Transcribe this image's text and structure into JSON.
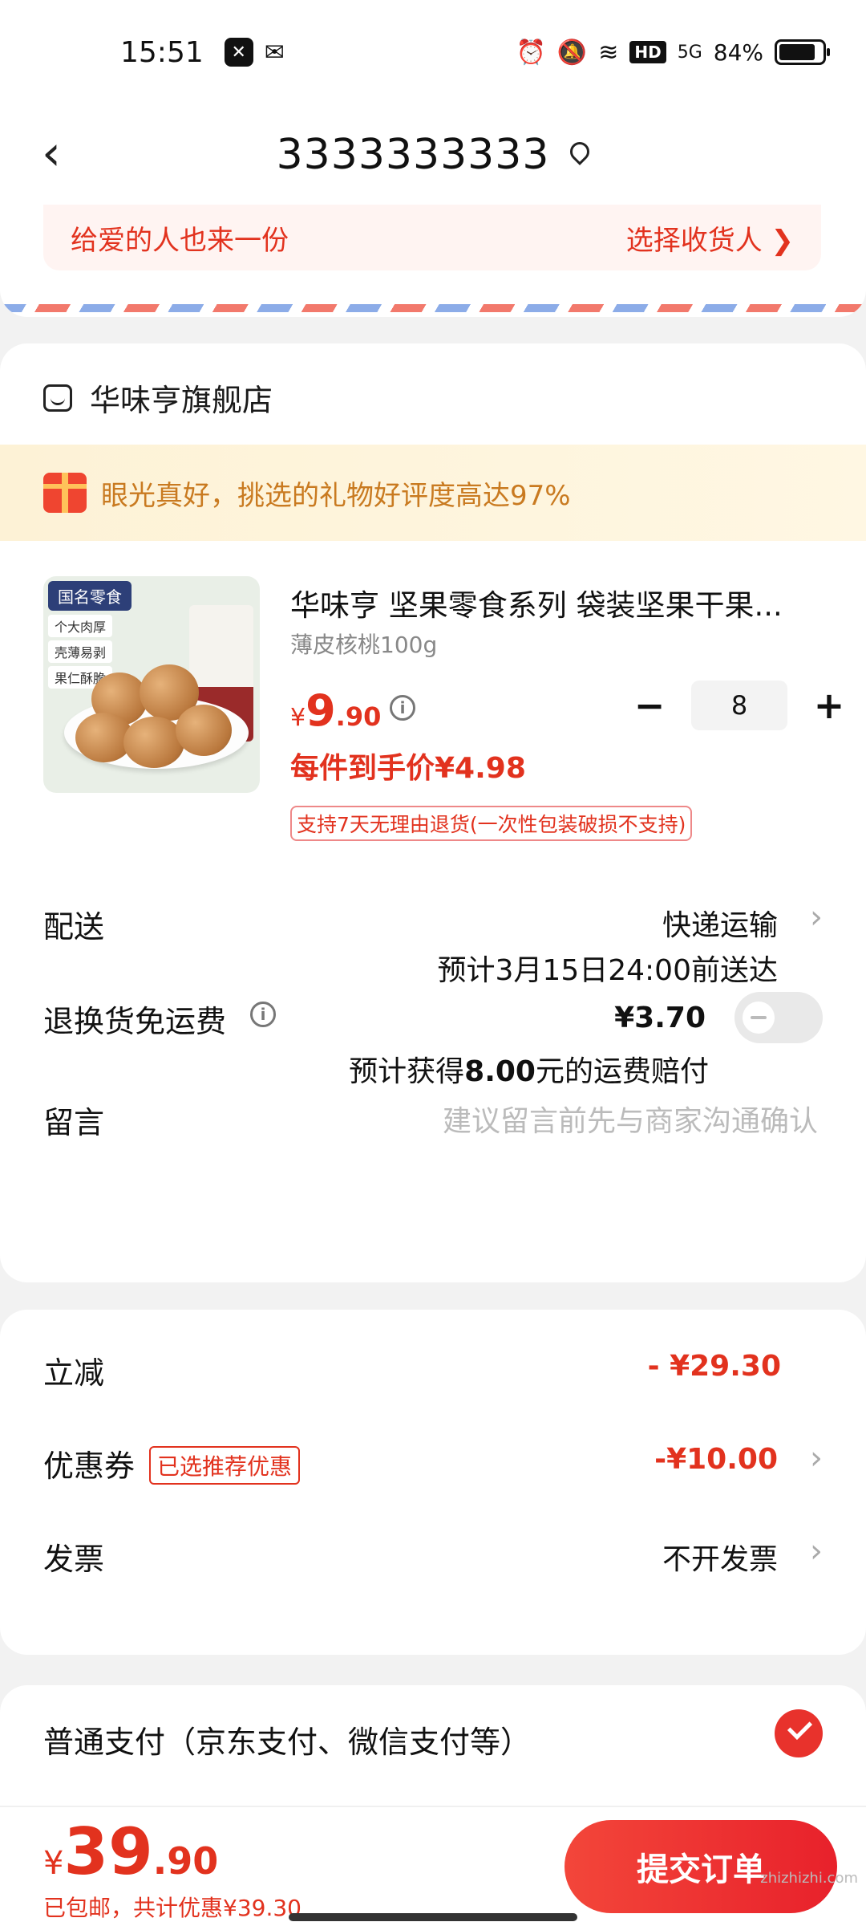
{
  "status_bar": {
    "time": "15:51",
    "battery": "84%",
    "network": "5G"
  },
  "nav": {
    "title": "3333333333"
  },
  "address": {
    "gift_text": "给爱的人也来一份",
    "select_recipient": "选择收货人 ❯"
  },
  "shop": {
    "name": "华味亨旗舰店",
    "promo_banner": "眼光真好，挑选的礼物好评度高达97%",
    "product": {
      "image_badge": "国名零食",
      "image_tags": [
        "个大肉厚",
        "壳薄易剥",
        "果仁酥脆"
      ],
      "title": "华味亨 坚果零食系列 袋装坚果干果...",
      "spec": "薄皮核桃100g",
      "price_currency": "¥",
      "price_int": "9",
      "price_dec": ".90",
      "quantity": "8",
      "minus": "−",
      "plus": "+",
      "unit_price": "每件到手价¥4.98",
      "return_policy": "支持7天无理由退货(一次性包装破损不支持)"
    },
    "delivery": {
      "label": "配送",
      "method": "快递运输",
      "eta": "预计3月15日24:00前送达"
    },
    "return_shipping": {
      "label": "退换货免运费",
      "price": "¥3.70",
      "note_prefix": "预计获得",
      "note_amount": "8.00",
      "note_suffix": "元的运费赔付",
      "enabled": false
    },
    "message": {
      "label": "留言",
      "placeholder": "建议留言前先与商家沟通确认"
    }
  },
  "discounts": {
    "instant": {
      "label": "立减",
      "value": "- ¥29.30"
    },
    "coupon": {
      "label": "优惠券",
      "tag": "已选推荐优惠",
      "value": "-¥10.00"
    },
    "invoice": {
      "label": "发票",
      "value": "不开发票"
    }
  },
  "payment": {
    "label": "普通支付（京东支付、微信支付等）",
    "selected": true
  },
  "footer": {
    "total_currency": "¥",
    "total_int": "39",
    "total_dec": ".90",
    "note_prefix": "已包邮，共计优惠",
    "note_amount": "¥39.30",
    "submit": "提交订单",
    "watermark": "zhizhizhi.com"
  },
  "colors": {
    "accent": "#e2321e",
    "banner": "#c97a20"
  }
}
